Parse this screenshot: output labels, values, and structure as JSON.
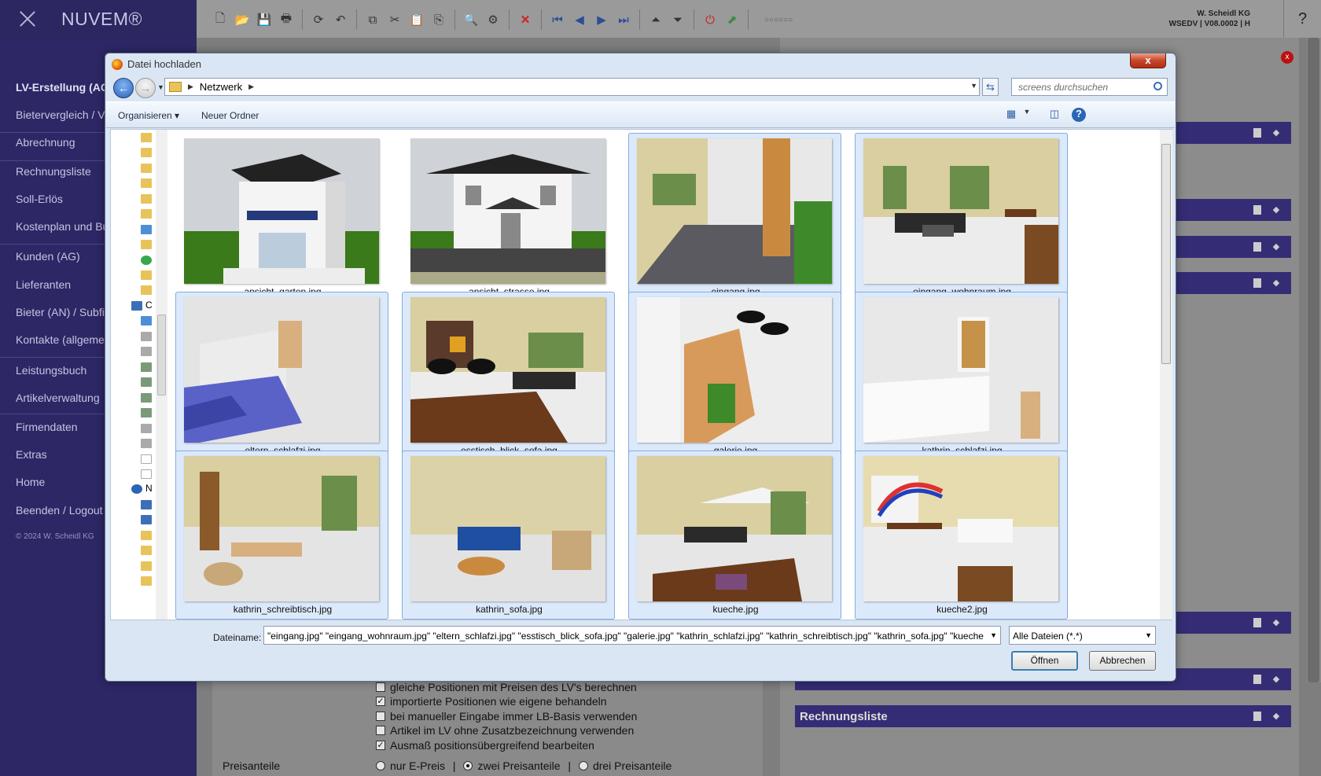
{
  "app": {
    "logo": "NUVEM®",
    "company": "W. Scheidl KG",
    "version": "WSEDV | V08.0002 | H",
    "help": "?"
  },
  "sidebar": {
    "items": [
      {
        "label": "LV-Erstellung (AG)",
        "bold": true
      },
      {
        "label": "Bietervergleich / Vergabe"
      },
      {
        "label": "Abrechnung"
      },
      {
        "label": "Rechnungsliste"
      },
      {
        "label": "Soll-Erlös"
      },
      {
        "label": "Kostenplan und Budget"
      },
      {
        "label": "Kunden (AG)"
      },
      {
        "label": "Lieferanten"
      },
      {
        "label": "Bieter (AN) / Subfirmen"
      },
      {
        "label": "Kontakte (allgemein)"
      },
      {
        "label": "Leistungsbuch"
      },
      {
        "label": "Artikelverwaltung"
      },
      {
        "label": "Firmendaten"
      },
      {
        "label": "Extras"
      },
      {
        "label": "Home"
      },
      {
        "label": "Beenden / Logout"
      }
    ],
    "copyright": "© 2024 W. Scheidl KG"
  },
  "background": {
    "options": [
      {
        "label": "gleiche Positionen mit Preisen des LV's berechnen",
        "checked": false
      },
      {
        "label": "importierte Positionen wie eigene behandeln",
        "checked": true
      },
      {
        "label": "bei manueller Eingabe immer LB-Basis verwenden",
        "checked": false
      },
      {
        "label": "Artikel im LV ohne Zusatzbezeichnung verwenden",
        "checked": false
      },
      {
        "label": "Ausmaß positionsübergreifend bearbeiten",
        "checked": true
      }
    ],
    "price_label": "Preisanteile",
    "price_options": [
      {
        "label": "nur E-Preis",
        "selected": false
      },
      {
        "label": "zwei Preisanteile",
        "selected": true
      },
      {
        "label": "drei Preisanteile",
        "selected": false
      }
    ],
    "right_panel_title": "Rechnungsliste",
    "close_badge": "x"
  },
  "dialog": {
    "title": "Datei hochladen",
    "close": "x",
    "address": "Netzwerk",
    "search_placeholder": "screens durchsuchen",
    "organize": "Organisieren",
    "new_folder": "Neuer Ordner",
    "files": [
      {
        "name": "ansicht_garten.jpg",
        "selected": false,
        "scene": "house1"
      },
      {
        "name": "ansicht_strasse.jpg",
        "selected": false,
        "scene": "house2"
      },
      {
        "name": "eingang.jpg",
        "selected": true,
        "scene": "hall"
      },
      {
        "name": "eingang_wohnraum.jpg",
        "selected": true,
        "scene": "living"
      },
      {
        "name": "eltern_schlafzi.jpg",
        "selected": true,
        "scene": "bed"
      },
      {
        "name": "esstisch_blick_sofa.jpg",
        "selected": true,
        "scene": "dining"
      },
      {
        "name": "galerie.jpg",
        "selected": true,
        "scene": "stairs"
      },
      {
        "name": "kathrin_schlafzi.jpg",
        "selected": true,
        "scene": "bed2"
      },
      {
        "name": "kathrin_schreibtisch.jpg",
        "selected": true,
        "scene": "desk"
      },
      {
        "name": "kathrin_sofa.jpg",
        "selected": true,
        "scene": "sofa"
      },
      {
        "name": "kueche.jpg",
        "selected": true,
        "scene": "kitchen"
      },
      {
        "name": "kueche2.jpg",
        "selected": true,
        "scene": "kitchen2"
      }
    ],
    "filename_label": "Dateiname:",
    "filename_value": "\"eingang.jpg\" \"eingang_wohnraum.jpg\" \"eltern_schlafzi.jpg\" \"esstisch_blick_sofa.jpg\" \"galerie.jpg\" \"kathrin_schlafzi.jpg\" \"kathrin_schreibtisch.jpg\" \"kathrin_sofa.jpg\" \"kueche",
    "filter": "Alle Dateien (*.*)",
    "open": "Öffnen",
    "cancel": "Abbrechen"
  }
}
